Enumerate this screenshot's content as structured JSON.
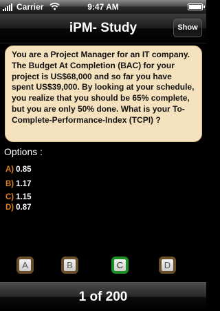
{
  "status_bar": {
    "carrier": "Carrier",
    "time": "9:47 AM",
    "signal_icon": "signal-bars-icon",
    "wifi_icon": "wifi-icon",
    "battery_icon": "battery-icon",
    "battery_level": 1.0
  },
  "nav": {
    "title": "iPM- Study",
    "show_label": "Show"
  },
  "question": {
    "text": "You are a Project Manager for an IT company. The Budget At Completion (BAC) for your project is US$68,000 and so far you have spent US$39,000. By looking at your schedule, you realize that you should be 65% complete, but you are only 50% done. What is your To-Complete-Performance-Index (TCPI) ?"
  },
  "options_label": "Options :",
  "options": [
    {
      "letter": "A)",
      "value": "0.85"
    },
    {
      "letter": "B)",
      "value": "1.17"
    },
    {
      "letter": "C)",
      "value": "1.15"
    },
    {
      "letter": "D)",
      "value": "0.87"
    }
  ],
  "answer_buttons": [
    {
      "label": "A",
      "selected": false
    },
    {
      "label": "B",
      "selected": false
    },
    {
      "label": "C",
      "selected": true
    },
    {
      "label": "D",
      "selected": false
    }
  ],
  "footer": {
    "counter": "1 of 200"
  },
  "colors": {
    "card_bg": "#f4e1bd",
    "option_letter": "#e07f1c",
    "button_border": "#6a4e28",
    "selected_border": "#1c8f24"
  }
}
